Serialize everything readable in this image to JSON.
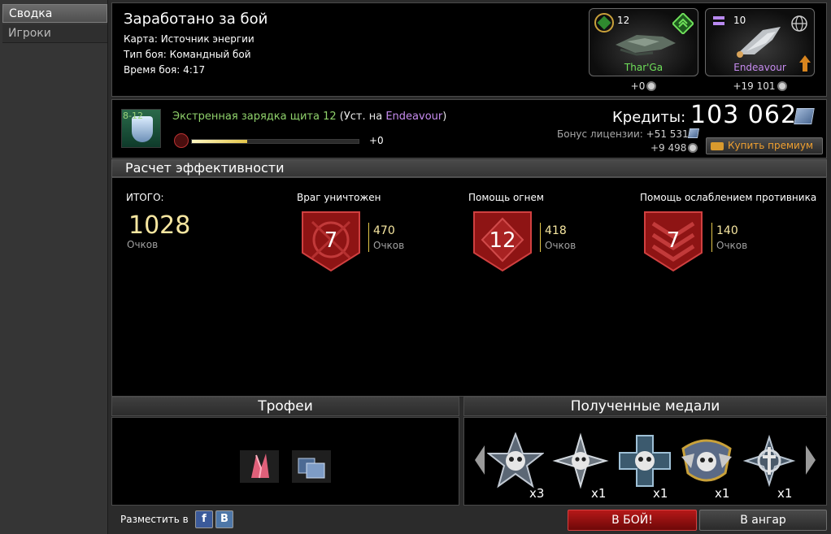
{
  "sidebar": {
    "tabs": [
      {
        "label": "Сводка",
        "active": true
      },
      {
        "label": "Игроки",
        "active": false
      }
    ]
  },
  "header": {
    "title": "Заработано за бой",
    "map_line": "Карта: Источник энергии",
    "type_line": "Тип боя: Командный бой",
    "time_line": "Время боя: 4:17"
  },
  "ships": [
    {
      "level": "12",
      "name": "Thar'Ga",
      "name_color": "#6fe05a",
      "reward": "+0",
      "icon": "corporation-badge-icon"
    },
    {
      "level": "10",
      "name": "Endeavour",
      "name_color": "#c78cf0",
      "reward": "+19 101",
      "icon": "globe-icon"
    }
  ],
  "module": {
    "level": "8-12",
    "name": "Экстренная зарядка щита 12",
    "install_prefix": " (Уст. на ",
    "install_ship": "Endeavour",
    "install_suffix": ")",
    "progress_fraction": 0.33,
    "xp_gain": "+0"
  },
  "credits": {
    "label": "Кредиты:",
    "value": "103 062",
    "license_bonus_label": "Бонус лицензии:",
    "license_bonus_value": "+51 531",
    "sub_value": "+9 498",
    "buy_premium": "Купить премиум"
  },
  "efficiency": {
    "title": "Расчет эффективности",
    "total_label": "ИТОГО:",
    "total_value": "1028",
    "total_unit": "Очков",
    "stats": [
      {
        "label": "Враг уничтожен",
        "count": "7",
        "points": "470",
        "unit": "Очков"
      },
      {
        "label": "Помощь огнем",
        "count": "12",
        "points": "418",
        "unit": "Очков"
      },
      {
        "label": "Помощь ослаблением противника",
        "count": "7",
        "points": "140",
        "unit": "Очков"
      }
    ]
  },
  "trophies": {
    "title": "Трофеи",
    "items": [
      "crystal-icon",
      "credits-icon"
    ]
  },
  "medals": {
    "title": "Полученные медали",
    "items": [
      {
        "icon": "skull-star-medal-icon",
        "count": "x3"
      },
      {
        "icon": "skull-compass-medal-icon",
        "count": "x1"
      },
      {
        "icon": "skull-cross-medal-icon",
        "count": "x1"
      },
      {
        "icon": "skull-wings-medal-icon",
        "count": "x1"
      },
      {
        "icon": "sword-star-medal-icon",
        "count": "x1"
      }
    ]
  },
  "footer": {
    "share_label": "Разместить в",
    "facebook": "f",
    "vkontakte": "B",
    "battle_button": "В БОЙ!",
    "hangar_button": "В ангар"
  },
  "colors": {
    "accent_gold": "#f6e6a0",
    "battle_red": "#b51818",
    "module_green": "#8fd16b",
    "ship_purple": "#c78cf0"
  }
}
